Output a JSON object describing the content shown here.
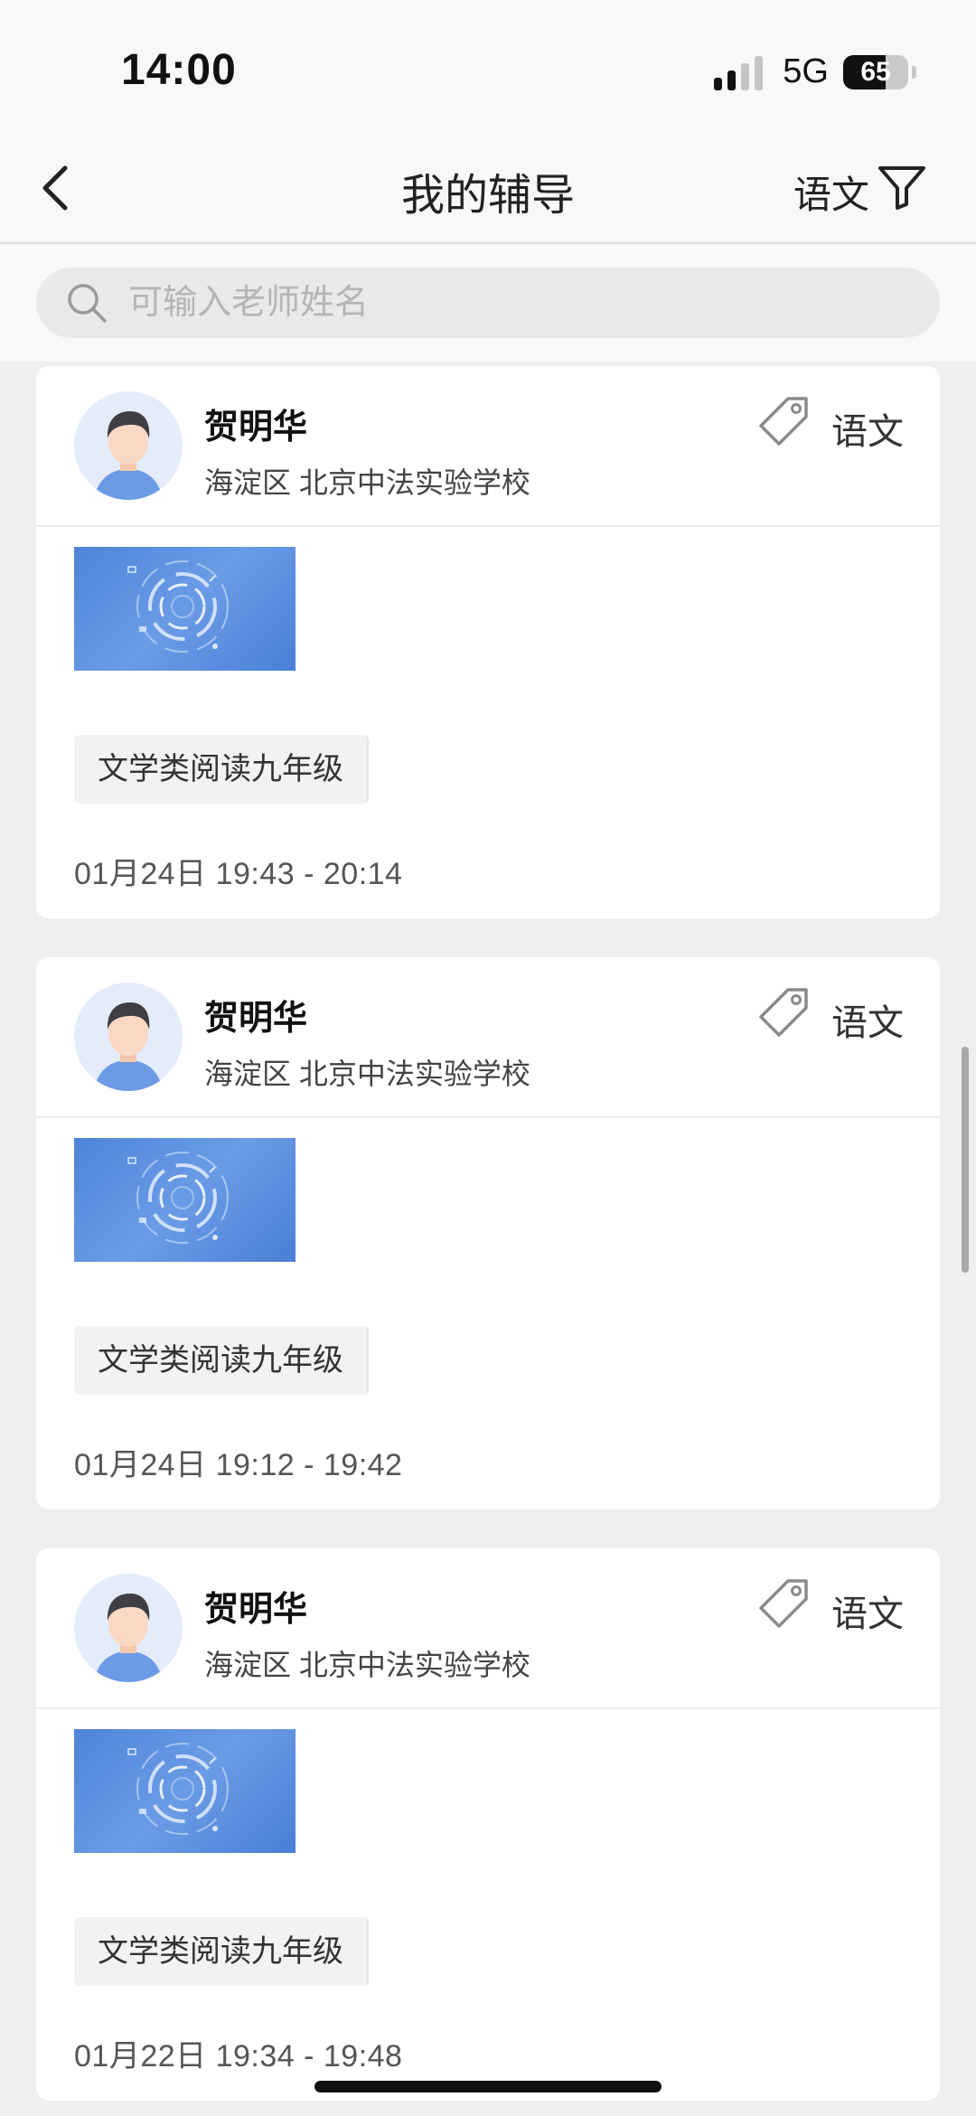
{
  "status_bar": {
    "time": "14:00",
    "network": "5G",
    "battery": "65",
    "battery_level": 0.65,
    "icons": [
      "signal-icon",
      "battery-icon"
    ]
  },
  "nav": {
    "title": "我的辅导",
    "filter_label": "语文",
    "icons": [
      "back-arrow-icon",
      "filter-icon"
    ]
  },
  "search": {
    "placeholder": "可输入老师姓名",
    "value": "",
    "icon": "search-icon"
  },
  "cards": [
    {
      "teacher_name": "贺明华",
      "school": "海淀区 北京中法实验学校",
      "subject": "语文",
      "topic": "文学类阅读九年级",
      "time": "01月24日 19:43 - 20:14"
    },
    {
      "teacher_name": "贺明华",
      "school": "海淀区 北京中法实验学校",
      "subject": "语文",
      "topic": "文学类阅读九年级",
      "time": "01月24日 19:12 - 19:42"
    },
    {
      "teacher_name": "贺明华",
      "school": "海淀区 北京中法实验学校",
      "subject": "语文",
      "topic": "文学类阅读九年级",
      "time": "01月22日 19:34 - 19:48"
    }
  ],
  "colors": {
    "accent": "#4e84d9",
    "background": "#efefef",
    "card": "#ffffff"
  }
}
